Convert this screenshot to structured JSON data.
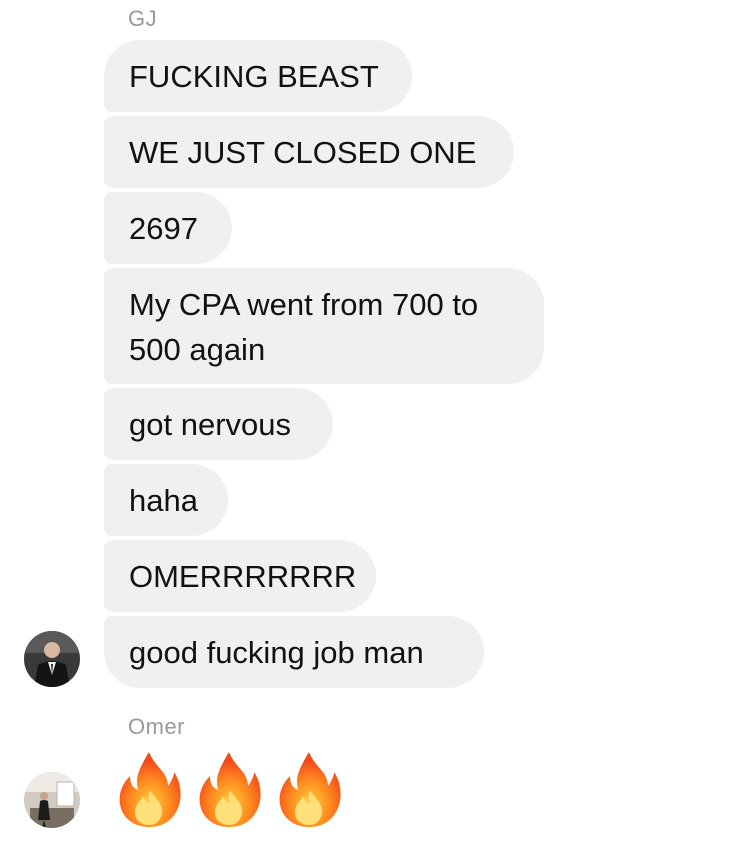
{
  "conversation": {
    "group1": {
      "sender": "GJ",
      "messages": [
        "FUCKING BEAST",
        "WE JUST CLOSED ONE",
        "2697",
        "My CPA went from 700 to 500 again",
        "got nervous",
        "haha",
        "OMERRRRRRR",
        "good fucking job man"
      ],
      "avatar": "profile-photo"
    },
    "group2": {
      "sender": "Omer",
      "emoji_message": "🔥🔥🔥",
      "emoji_icons": [
        "fire-icon",
        "fire-icon",
        "fire-icon"
      ],
      "avatar": "profile-photo"
    }
  },
  "colors": {
    "bubble_bg": "#f0f0f0",
    "text": "#111111",
    "sender_label": "#9a9a9a"
  }
}
